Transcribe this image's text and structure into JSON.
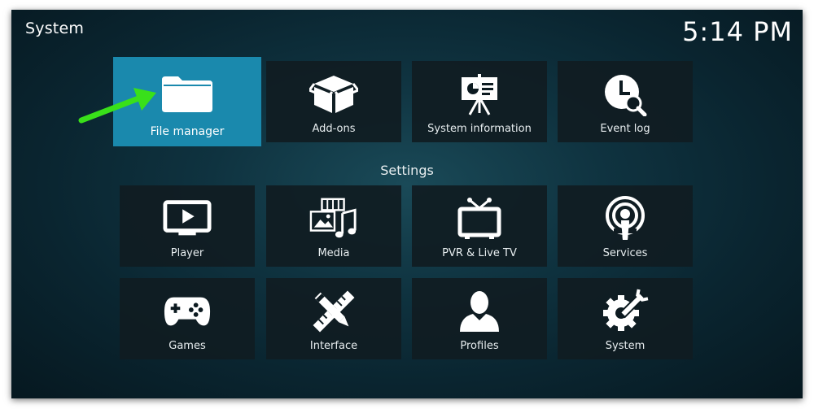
{
  "window": {
    "title": "System",
    "clock": "5:14 PM"
  },
  "top_tiles": [
    {
      "label": "File manager",
      "icon": "folder-icon",
      "focused": true
    },
    {
      "label": "Add-ons",
      "icon": "box-icon"
    },
    {
      "label": "System information",
      "icon": "presentation-icon"
    },
    {
      "label": "Event log",
      "icon": "clock-search-icon"
    }
  ],
  "settings": {
    "heading": "Settings",
    "tiles": [
      {
        "label": "Player",
        "icon": "tv-play-icon"
      },
      {
        "label": "Media",
        "icon": "media-icon"
      },
      {
        "label": "PVR & Live TV",
        "icon": "tv-antenna-icon"
      },
      {
        "label": "Services",
        "icon": "podcast-icon"
      },
      {
        "label": "Games",
        "icon": "gamepad-icon"
      },
      {
        "label": "Interface",
        "icon": "pencil-ruler-icon"
      },
      {
        "label": "Profiles",
        "icon": "user-icon"
      },
      {
        "label": "System",
        "icon": "gear-wrench-icon"
      }
    ]
  },
  "colors": {
    "focus": "#1a89ad",
    "annotation_arrow": "#39e01a"
  }
}
